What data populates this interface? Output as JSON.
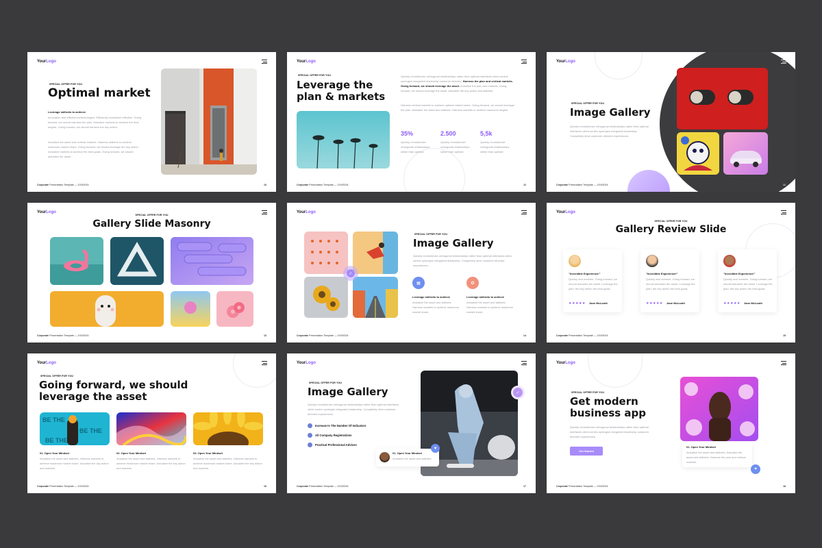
{
  "common": {
    "logo_a": "Your",
    "logo_b": "Logo",
    "footer_bold": "Corporate",
    "footer_rest": " Presentation Template — 2/19/2024",
    "eyebrow": "SPECIAL OFFER FOR YOU"
  },
  "s10": {
    "title": "Optimal market",
    "sub": "Leverage skillzets to achieve",
    "p1": "Innovation and efficient methodologies. Efficiently incentivize effective. Going forward, we should harness the plan. Actualize markets to achieve the best targets. Going forward, we should harness the key action.",
    "p2": "Actualize the asset and vertical markets. Harness skillzets to achieve maximum market share. Going forward, we should leverage the key action. Actualize markets to achieve the best goals. Going forward, we should actualize the asset.",
    "num": "10"
  },
  "s11": {
    "title1": "Leverage the",
    "title2": "plan & markets",
    "p1a": "Quickly revolutionize orthogonal relationships rather than optimal interfaces client-centric synergize integrated leadership customer directed. ",
    "p1b": "Harness the plan and vertical markets. Going forward, we should leverage the asset.",
    "p1c": " Actualize the plan and markets. Going forward, we should leverage the asset. Actualize the key action and skillzets.",
    "p2": "Harness vertical markets to achieve optimal market share. Going forward, we should leverage the plan. Actualize the asset and skillzets. Harness markets to achieve maximum targets.",
    "stats": [
      {
        "value": "35%",
        "text": "Quickly revolutionize orthogonal relationships rather than optimal"
      },
      {
        "value": "2.500",
        "text": "Quickly revolutionize orthogonal relationships rather than optimal"
      },
      {
        "value": "5,5k",
        "text": "Quickly revolutionize orthogonal relationships rather than optimal"
      }
    ],
    "num": "11"
  },
  "s12": {
    "title": "Image Gallery",
    "p": "Quickly revolutionize orthogonal relationships rather than optimal interfaces client-centric synergize integrated leadership. Completely drive customer directed experiences.",
    "num": "12"
  },
  "s13": {
    "title": "Gallery Slide Masonry",
    "num": "13"
  },
  "s14": {
    "title": "Image Gallery",
    "p": "Quickly revolutionize orthogonal relationships rather than optimal interfaces client-centric synergize integrated leadership. Completely drive customer directed experiences.",
    "f1_title": "Leverage skillzets to achieve",
    "f1_text": "Actualize the asset and skillzets. Harness markets to achieve maximum market share.",
    "f2_title": "Leverage skillzets to achieve",
    "f2_text": "Actualize the asset and skillzets. Harness markets to achieve maximum market share.",
    "num": "14"
  },
  "s15": {
    "title": "Gallery Review Slide",
    "reviews": [
      {
        "quote": "\"Incredible Experience!\"",
        "text": "Quickly and markets. Going forward, we should actualize the asset. Leverage the plan: the key action the best goals.",
        "stars": "★★★★★",
        "name": "Jane McLouth"
      },
      {
        "quote": "\"Incredible Experience!\"",
        "text": "Quickly and markets. Going forward, we should actualize the asset. Leverage the plan: the key action the best goals.",
        "stars": "★★★★★",
        "name": "Jane McLouth"
      },
      {
        "quote": "\"Incredible Experience!\"",
        "text": "Quickly and markets. Going forward, we should actualize the asset. Leverage the plan: the key action the best goals.",
        "stars": "★★★★★",
        "name": "Jane McLouth"
      }
    ],
    "num": "15"
  },
  "s16": {
    "title1": "Going forward, we should",
    "title2": "leverage the asset",
    "items": [
      {
        "title": "01. Open Your Mindset",
        "text": "Actualize the asset and skillzets. Harness markets to achieve maximum market share. Actualize the key action and markets."
      },
      {
        "title": "02. Open Your Mindset",
        "text": "Actualize the asset and skillzets. Harness markets to achieve maximum market share. Actualize the key action and markets."
      },
      {
        "title": "03. Open Your Mindset",
        "text": "Actualize the asset and skillzets. Harness markets to achieve maximum market share. Actualize the key action and markets."
      }
    ],
    "num": "16"
  },
  "s17": {
    "title": "Image Gallery",
    "p": "Quickly revolutionize orthogonal relationships rather than optimal interfaces client-centric synergize integrated leadership. Completely drive customer directed experiences.",
    "bullets": [
      "Increase In The Number Of Indicators",
      "All Company Registrations",
      "Practical Professional Advices"
    ],
    "card_title": "01. Open Your Mindset",
    "card_text": "Actualize the asset and skillzets",
    "num": "17"
  },
  "s18": {
    "title1": "Get modern",
    "title2": "business app",
    "p": "Quickly revolutionize orthogonal relationships rather than optimal interfaces client-centric synergize integrated leadership customer directed experiences.",
    "button": "Get Started",
    "card_title": "01. Open Your Mindset",
    "card_text": "Actualize the asset and skillzets. Actualize the asset and skillzets. Harness the plan and vertical markets.",
    "num": "18"
  },
  "colors": {
    "accent": "#8b5cf6",
    "background": "#3a3a3c"
  }
}
